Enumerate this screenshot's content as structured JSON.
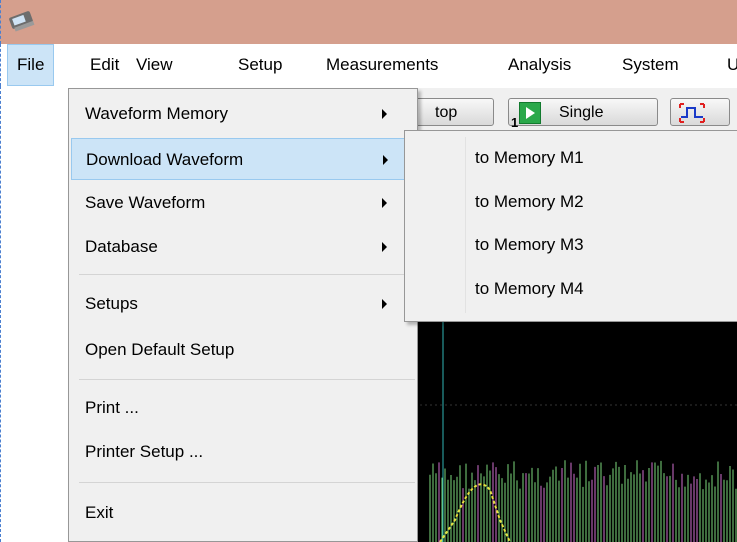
{
  "app": {
    "icon": "oscilloscope-app-icon"
  },
  "menubar": {
    "items": [
      {
        "label": "File"
      },
      {
        "label": "Edit"
      },
      {
        "label": "View"
      },
      {
        "label": "Setup"
      },
      {
        "label": "Measurements"
      },
      {
        "label": "Analysis"
      },
      {
        "label": "System"
      },
      {
        "label": "U"
      }
    ]
  },
  "toolbar": {
    "stop_label": "top",
    "single_label": "Single",
    "single_badge": "1"
  },
  "file_menu": {
    "items": [
      {
        "label": "Waveform Memory"
      },
      {
        "label": "Download Waveform"
      },
      {
        "label": "Save Waveform"
      },
      {
        "label": "Database"
      },
      {
        "label": "Setups"
      },
      {
        "label": "Open Default Setup"
      },
      {
        "label": "Print ..."
      },
      {
        "label": "Printer Setup ..."
      },
      {
        "label": "Exit"
      }
    ]
  },
  "download_submenu": {
    "items": [
      {
        "label": "to Memory M1"
      },
      {
        "label": "to Memory M2"
      },
      {
        "label": "to Memory M3"
      },
      {
        "label": "to Memory M4"
      }
    ]
  },
  "colors": {
    "titlebar": "#d59f8d",
    "menu_highlight": "#cce4f7",
    "trace_green": "#7dd87d",
    "trace_magenta": "#d070d0",
    "trace_yellow": "#e8e040"
  }
}
